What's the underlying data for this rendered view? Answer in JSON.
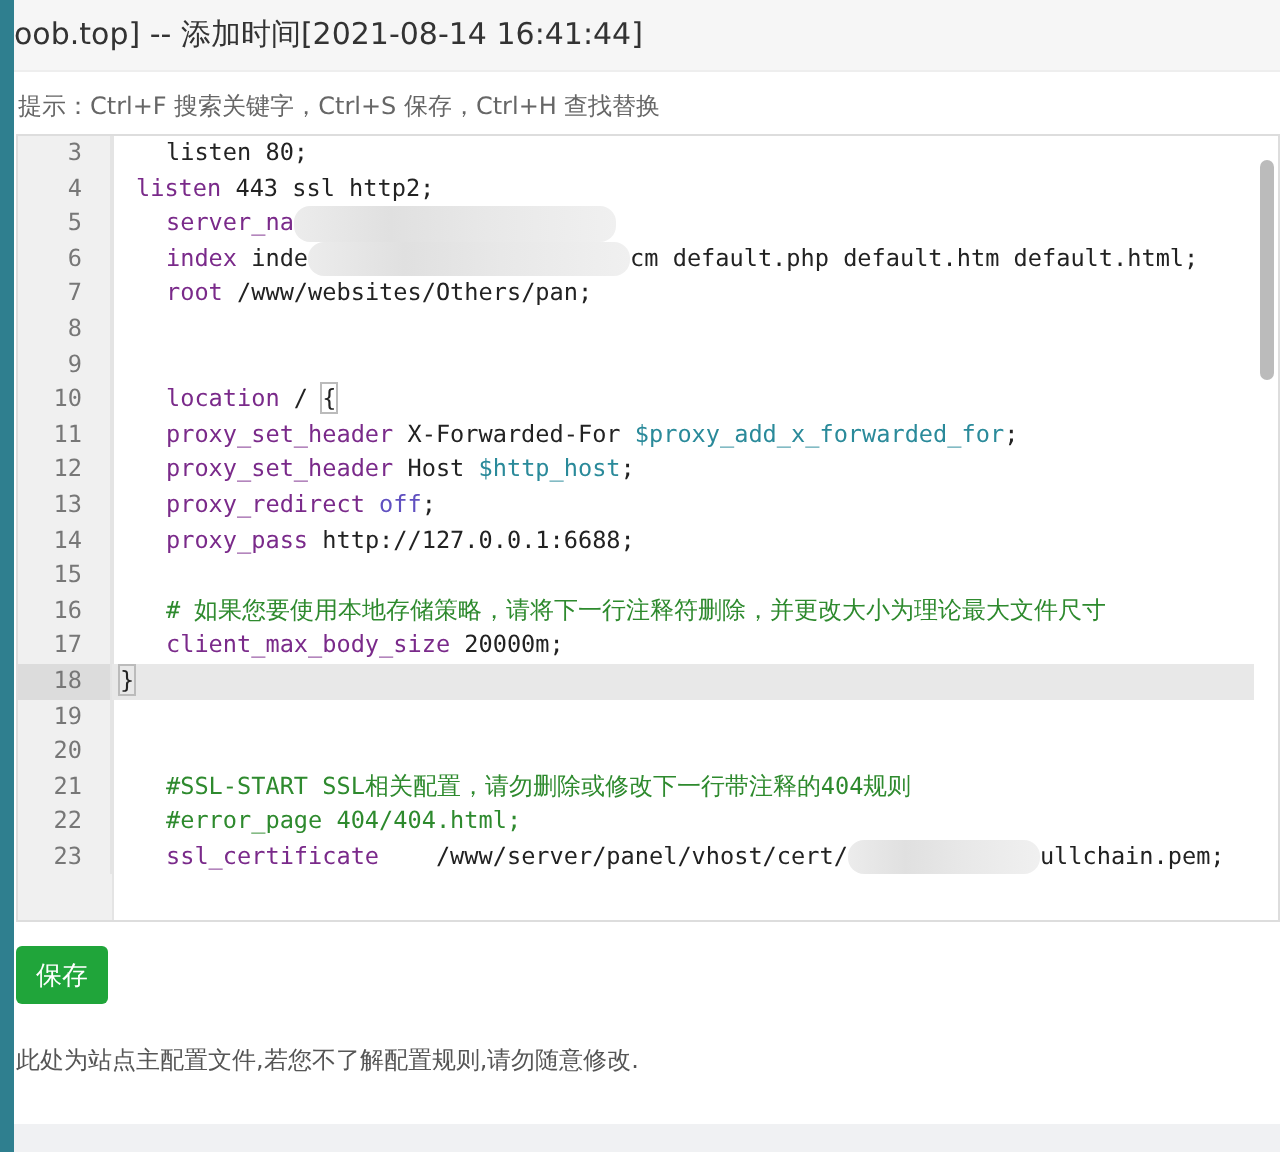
{
  "title": "oob.top] -- 添加时间[2021-08-14 16:41:44]",
  "hint": "提示：Ctrl+F 搜索关键字，Ctrl+S 保存，Ctrl+H 查找替换",
  "editor": {
    "lines": [
      {
        "number": "3",
        "kind": "nested",
        "tokens": [
          {
            "kind": "plain",
            "text": "listen 80;"
          }
        ]
      },
      {
        "number": "4",
        "kind": "block",
        "tokens": [
          {
            "kind": "kw",
            "text": "listen"
          },
          {
            "kind": "plain",
            "text": " 443 ssl http2;"
          }
        ]
      },
      {
        "number": "5",
        "kind": "nested",
        "tokens": [
          {
            "kind": "kw",
            "text": "server_na"
          },
          {
            "kind": "blur"
          }
        ]
      },
      {
        "number": "6",
        "kind": "nested",
        "tokens": [
          {
            "kind": "kw",
            "text": "index"
          },
          {
            "kind": "plain",
            "text": " inde"
          },
          {
            "kind": "blur"
          },
          {
            "kind": "plain",
            "text": "cm default.php default.htm default.html;"
          }
        ]
      },
      {
        "number": "7",
        "kind": "nested",
        "tokens": [
          {
            "kind": "kw",
            "text": "root"
          },
          {
            "kind": "plain",
            "text": " /www/websites/Others/pan;"
          }
        ]
      },
      {
        "number": "8",
        "kind": "nested"
      },
      {
        "number": "9",
        "kind": "nested"
      },
      {
        "number": "10",
        "kind": "nested",
        "tokens": [
          {
            "kind": "kw",
            "text": "location"
          },
          {
            "kind": "plain",
            "text": " / "
          },
          {
            "kind": "bracket",
            "text": "{"
          }
        ]
      },
      {
        "number": "11",
        "kind": "nested",
        "tokens": [
          {
            "kind": "kw",
            "text": "proxy_set_header"
          },
          {
            "kind": "plain",
            "text": " X-Forwarded-For "
          },
          {
            "kind": "var",
            "text": "$proxy_add_x_forwarded_for"
          },
          {
            "kind": "plain",
            "text": ";"
          }
        ]
      },
      {
        "number": "12",
        "kind": "nested",
        "tokens": [
          {
            "kind": "kw",
            "text": "proxy_set_header"
          },
          {
            "kind": "plain",
            "text": " Host "
          },
          {
            "kind": "var",
            "text": "$http_host"
          },
          {
            "kind": "plain",
            "text": ";"
          }
        ]
      },
      {
        "number": "13",
        "kind": "nested",
        "tokens": [
          {
            "kind": "kw",
            "text": "proxy_redirect"
          },
          {
            "kind": "atom",
            "text": " off"
          },
          {
            "kind": "plain",
            "text": ";"
          }
        ]
      },
      {
        "number": "14",
        "kind": "nested",
        "tokens": [
          {
            "kind": "kw",
            "text": "proxy_pass"
          },
          {
            "kind": "plain",
            "text": " http://127.0.0.1:6688;"
          }
        ]
      },
      {
        "number": "15",
        "kind": "nested"
      },
      {
        "number": "16",
        "kind": "nested",
        "tokens": [
          {
            "kind": "comment",
            "text": "# 如果您要使用本地存储策略，请将下一行注释符删除，并更改大小为理论最大文件尺寸"
          }
        ]
      },
      {
        "number": "17",
        "kind": "nested",
        "tokens": [
          {
            "kind": "kw",
            "text": "client_max_body_size"
          },
          {
            "kind": "plain",
            "text": " 20000m;"
          }
        ]
      },
      {
        "number": "18",
        "kind": "top",
        "active": true,
        "tokens": [
          {
            "kind": "bracket",
            "text": "}"
          }
        ]
      },
      {
        "number": "19",
        "kind": "nested"
      },
      {
        "number": "20",
        "kind": "nested"
      },
      {
        "number": "21",
        "kind": "nested",
        "tokens": [
          {
            "kind": "comment",
            "text": "#SSL-START SSL相关配置，请勿删除或修改下一行带注释的404规则"
          }
        ]
      },
      {
        "number": "22",
        "kind": "nested",
        "tokens": [
          {
            "kind": "comment",
            "text": "#error_page 404/404.html;"
          }
        ]
      },
      {
        "number": "23",
        "kind": "nested",
        "tokens": [
          {
            "kind": "kw",
            "text": "ssl_certificate"
          },
          {
            "kind": "plain",
            "text": "    /www/server/panel/vhost/cert/"
          },
          {
            "kind": "blur_short"
          },
          {
            "kind": "plain",
            "text": "ullchain.pem;"
          }
        ]
      }
    ]
  },
  "save_button": "保存",
  "footer_note": "此处为站点主配置文件,若您不了解配置规则,请勿随意修改."
}
